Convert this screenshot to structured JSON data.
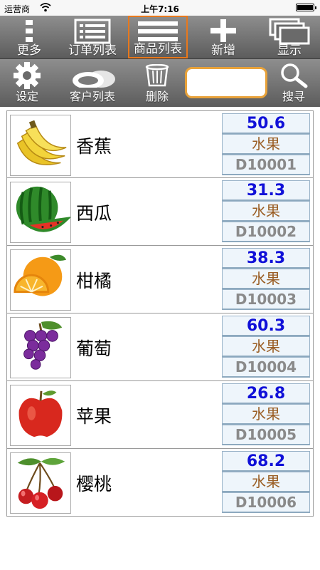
{
  "status": {
    "carrier": "运营商",
    "time": "上午7:16"
  },
  "toolbar": {
    "more_label": "更多",
    "orders_label": "订单列表",
    "products_label": "商品列表",
    "add_label": "新增",
    "display_label": "显示",
    "settings_label": "设定",
    "customers_label": "客户列表",
    "delete_label": "删除",
    "search_label": "搜寻",
    "search_value": ""
  },
  "products": [
    {
      "name": "香蕉",
      "price": "50.6",
      "category": "水果",
      "code": "D10001",
      "icon": "banana-icon"
    },
    {
      "name": "西瓜",
      "price": "31.3",
      "category": "水果",
      "code": "D10002",
      "icon": "watermelon-icon"
    },
    {
      "name": "柑橘",
      "price": "38.3",
      "category": "水果",
      "code": "D10003",
      "icon": "orange-icon"
    },
    {
      "name": "葡萄",
      "price": "60.3",
      "category": "水果",
      "code": "D10004",
      "icon": "grapes-icon"
    },
    {
      "name": "苹果",
      "price": "26.8",
      "category": "水果",
      "code": "D10005",
      "icon": "apple-icon"
    },
    {
      "name": "樱桃",
      "price": "68.2",
      "category": "水果",
      "code": "D10006",
      "icon": "cherry-icon"
    }
  ],
  "colors": {
    "toolbar": "#777777",
    "active_border": "#e8781c",
    "price": "#1010d8",
    "category": "#9a5d23",
    "code": "#8a8a8a"
  }
}
